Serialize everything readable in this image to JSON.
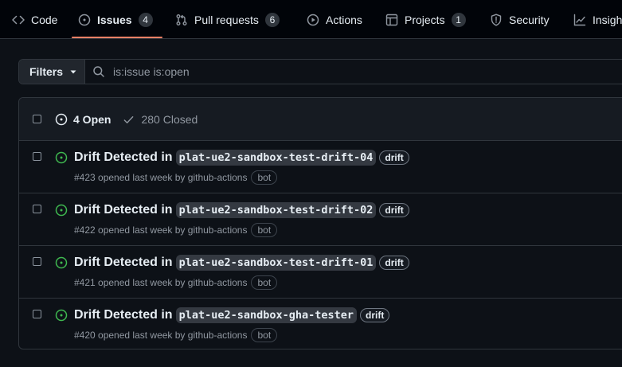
{
  "nav": {
    "tabs": [
      {
        "label": "Code"
      },
      {
        "label": "Issues",
        "count": "4"
      },
      {
        "label": "Pull requests",
        "count": "6"
      },
      {
        "label": "Actions"
      },
      {
        "label": "Projects",
        "count": "1"
      },
      {
        "label": "Security"
      },
      {
        "label": "Insights"
      }
    ]
  },
  "filterbar": {
    "filters_label": "Filters",
    "search_value": "is:issue is:open"
  },
  "issues_header": {
    "open_label": "4 Open",
    "closed_label": "280 Closed"
  },
  "issues": [
    {
      "title_prefix": "Drift Detected in",
      "code": "plat-ue2-sandbox-test-drift-04",
      "label": "drift",
      "meta": "#423 opened last week by github-actions",
      "author_badge": "bot"
    },
    {
      "title_prefix": "Drift Detected in",
      "code": "plat-ue2-sandbox-test-drift-02",
      "label": "drift",
      "meta": "#422 opened last week by github-actions",
      "author_badge": "bot"
    },
    {
      "title_prefix": "Drift Detected in",
      "code": "plat-ue2-sandbox-test-drift-01",
      "label": "drift",
      "meta": "#421 opened last week by github-actions",
      "author_badge": "bot"
    },
    {
      "title_prefix": "Drift Detected in",
      "code": "plat-ue2-sandbox-gha-tester",
      "label": "drift",
      "meta": "#420 opened last week by github-actions",
      "author_badge": "bot"
    }
  ],
  "colors": {
    "background": "#0d1117",
    "open_green": "#3fb950",
    "selected_tab_underline": "#f78166"
  }
}
